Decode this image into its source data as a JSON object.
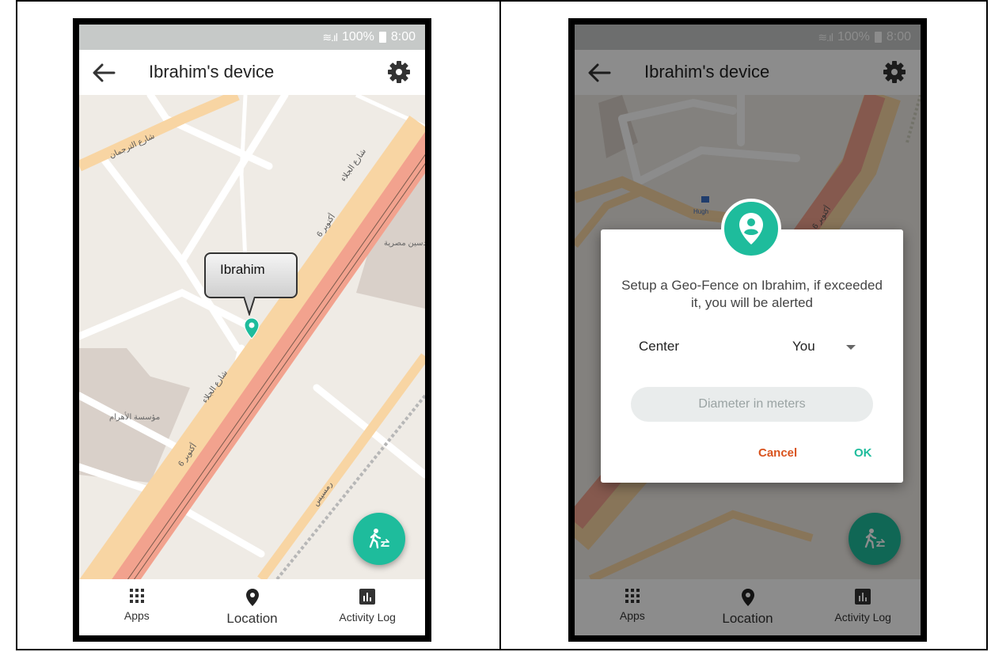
{
  "status": {
    "battery": "100%",
    "time": "8:00"
  },
  "app_bar": {
    "title": "Ibrahim's device"
  },
  "bubble": {
    "name": "Ibrahim"
  },
  "nav": {
    "apps": "Apps",
    "location": "Location",
    "activity": "Activity Log"
  },
  "dialog": {
    "message": "Setup a Geo-Fence on Ibrahim, if exceeded it, you will be alerted",
    "center_label": "Center",
    "center_value": "You",
    "diameter_placeholder": "Diameter in meters",
    "cancel": "Cancel",
    "ok": "OK"
  },
  "map_labels": {
    "street_top": "شارع الترجمان",
    "street_a": "شارع الجلاء",
    "street_b": "6 أكتوبر",
    "poi_left": "مؤسسة الأهرام",
    "poi_right": "نقابة مهندسين مصرية",
    "street_ramses": "رمسيس"
  },
  "colors": {
    "accent": "#1ebc9c",
    "cancel": "#d9531e",
    "highway": "#f2a28e",
    "road": "#f8d5a3"
  },
  "icons": [
    "back-arrow-icon",
    "gear-icon",
    "apps-grid-icon",
    "location-pin-icon",
    "activity-chart-icon",
    "walk-switch-icon",
    "geofence-person-icon"
  ]
}
